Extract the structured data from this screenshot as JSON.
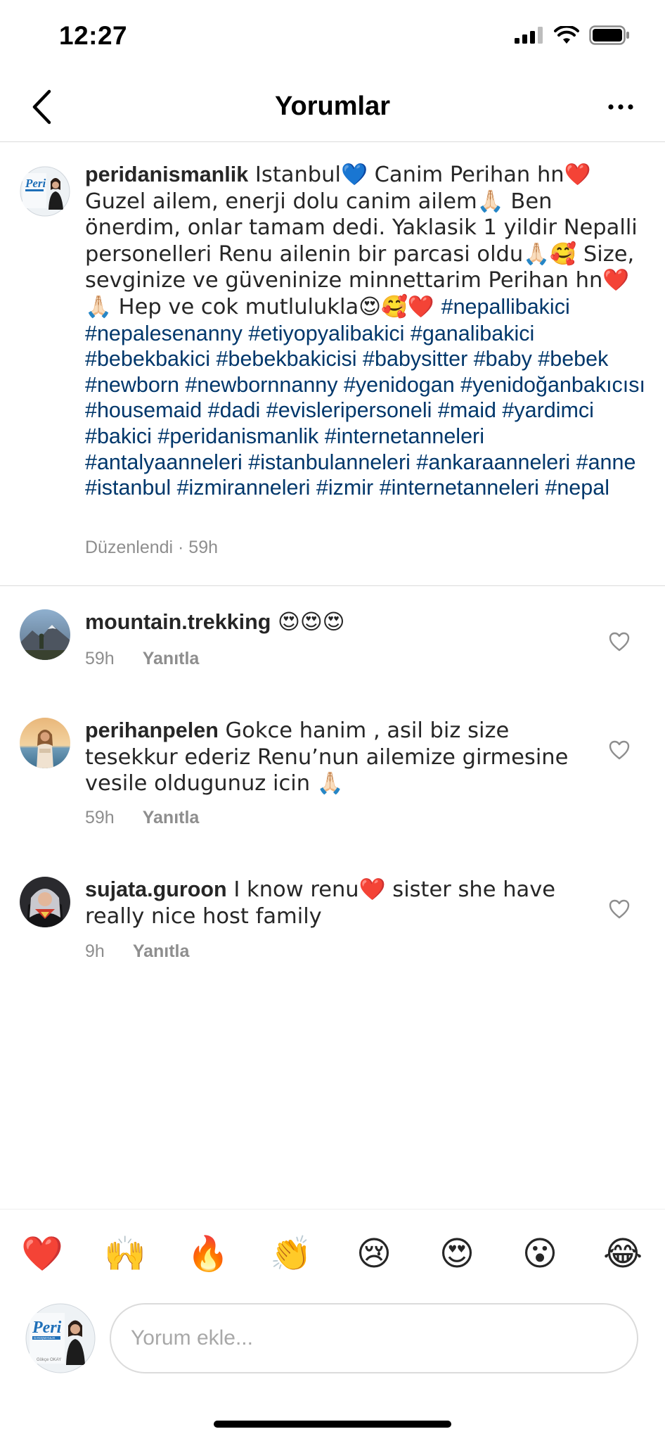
{
  "status_bar": {
    "time": "12:27"
  },
  "nav": {
    "title": "Yorumlar"
  },
  "caption": {
    "username": "peridanismanlik",
    "text": " Istanbul💙 Canim Perihan hn❤️ Guzel ailem, enerji dolu canim ailem🙏🏻 Ben önerdim, onlar tamam dedi. Yaklasik 1 yildir Nepalli personelleri Renu ailenin bir parcasi oldu🙏🏻🥰 Size, sevginize ve güveninize minnettarim Perihan hn❤️🙏🏻 Hep ve cok mutlulukla😍🥰❤️ ",
    "hashtags": "#nepallibakici #nepalesenanny #etiyopyalibakici #ganalibakici #bebekbakici #bebekbakicisi #babysitter #baby #bebek #newborn #newbornnanny #yenidogan #yenidoğanbakıcısı #housemaid #dadi #evisleripersoneli #maid #yardimci #bakici #peridanismanlik #internetanneleri #antalyaanneleri #istanbulanneleri #ankaraanneleri #anne #istanbul #izmiranneleri #izmir #internetanneleri #nepal",
    "meta": "Düzenlendi · 59h"
  },
  "comments": [
    {
      "username": "mountain.trekking",
      "text": " 😍😍😍",
      "time": "59h",
      "reply": "Yanıtla"
    },
    {
      "username": "perihanpelen",
      "text": " Gokce hanim , asil biz size tesekkur ederiz Renu’nun ailemize girmesine vesile oldugunuz icin 🙏🏻",
      "time": "59h",
      "reply": "Yanıtla"
    },
    {
      "username": "sujata.guroon",
      "text": " I know renu❤️ sister she have really nice host family",
      "time": "9h",
      "reply": "Yanıtla"
    }
  ],
  "emoji_bar": [
    "❤️",
    "🙌",
    "🔥",
    "👏",
    "😢",
    "😍",
    "😮",
    "😂"
  ],
  "composer": {
    "placeholder": "Yorum ekle..."
  },
  "avatar_logo": {
    "brand": "Peri",
    "sub": "DANIŞMANLIK",
    "name": "Gökçe OKAY"
  },
  "colors": {
    "hashtag": "#00376b",
    "muted": "#8e8e8e",
    "text": "#262626",
    "brand_blue": "#1e6fb8"
  }
}
